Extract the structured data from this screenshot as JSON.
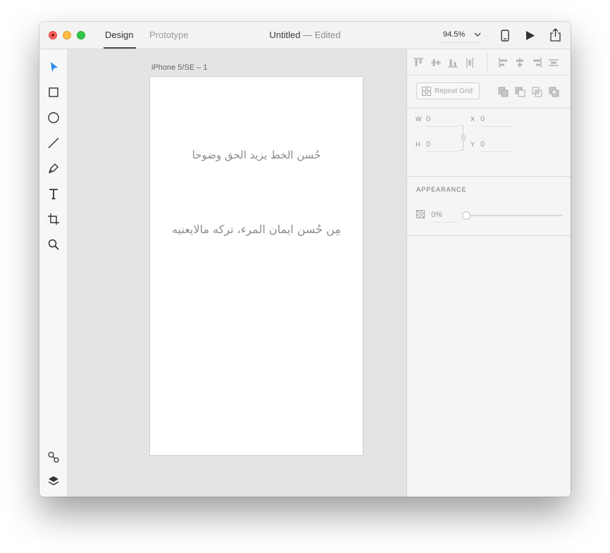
{
  "window": {
    "traffic_lights": [
      "close",
      "minimize",
      "zoom"
    ],
    "mode_tabs": [
      {
        "label": "Design",
        "active": true
      },
      {
        "label": "Prototype",
        "active": false
      }
    ],
    "title": "Untitled",
    "title_status": "— Edited",
    "zoom_level": "94.5%"
  },
  "toolbar": {
    "tools": [
      "select-icon",
      "rectangle-icon",
      "ellipse-icon",
      "line-icon",
      "pen-icon",
      "text-icon",
      "artboard-icon",
      "zoom-icon"
    ],
    "bottom": [
      "symbols-icon",
      "layers-icon"
    ],
    "accent_color": "#2d8ceb"
  },
  "canvas": {
    "artboard_label": "iPhone 5/SE – 1",
    "texts": [
      "حُسن الخط يزيد الحق وضوحا",
      "مِن حُسن ايمان المرء، تركه مالايعنيه"
    ]
  },
  "inspector": {
    "repeat_grid_label": "Repeat Grid",
    "dims": {
      "w_label": "W",
      "w_value": "0",
      "h_label": "H",
      "h_value": "0",
      "x_label": "X",
      "x_value": "0",
      "y_label": "Y",
      "y_value": "0"
    },
    "appearance": {
      "title": "APPEARANCE",
      "opacity_value": "0%",
      "opacity_fraction": 0
    }
  }
}
